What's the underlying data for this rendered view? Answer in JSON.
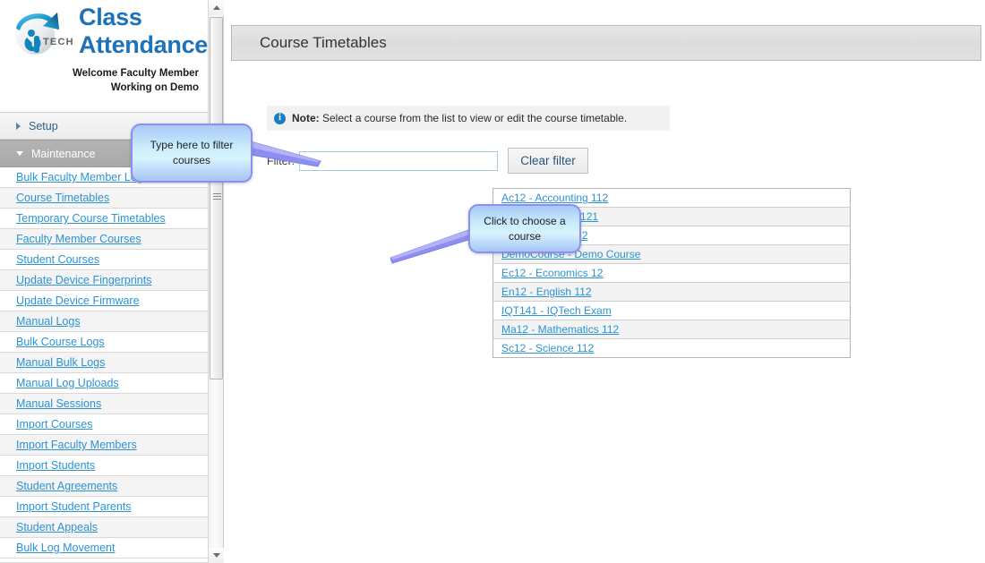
{
  "brand": {
    "logo_icon": "iqtech-globe-logo",
    "title_line1": "Class",
    "title_line2": "Attendance",
    "welcome_line1": "Welcome Faculty Member",
    "welcome_line2": "Working on Demo",
    "accent_color": "#1d72b8"
  },
  "sidebar": {
    "sections": [
      {
        "label": "Setup",
        "expanded": false,
        "icon": "chevron-right-icon"
      },
      {
        "label": "Maintenance",
        "expanded": true,
        "icon": "chevron-down-icon"
      }
    ],
    "items": [
      {
        "label": "Bulk Faculty Member Logs"
      },
      {
        "label": "Course Timetables"
      },
      {
        "label": "Temporary Course Timetables"
      },
      {
        "label": "Faculty Member Courses"
      },
      {
        "label": "Student Courses"
      },
      {
        "label": "Update Device Fingerprints"
      },
      {
        "label": "Update Device Firmware"
      },
      {
        "label": "Manual Logs"
      },
      {
        "label": "Bulk Course Logs"
      },
      {
        "label": "Manual Bulk Logs"
      },
      {
        "label": "Manual Log Uploads"
      },
      {
        "label": "Manual Sessions"
      },
      {
        "label": "Import Courses"
      },
      {
        "label": "Import Faculty Members"
      },
      {
        "label": "Import Students"
      },
      {
        "label": "Student Agreements"
      },
      {
        "label": "Import Student Parents"
      },
      {
        "label": "Student Appeals"
      },
      {
        "label": "Bulk Log Movement"
      }
    ],
    "link_color": "#2b93d4"
  },
  "scrollbar": {
    "up_arrow_icon": "scroll-up-arrow-icon",
    "down_arrow_icon": "scroll-down-arrow-icon",
    "grip_icon": "scrollbar-grip-icon"
  },
  "main": {
    "page_title": "Course Timetables",
    "note": {
      "icon": "info-icon",
      "prefix": "Note:",
      "text": " Select a course from the list to view or edit the course timetable."
    },
    "filter": {
      "label": "Filter:",
      "value": "",
      "placeholder": "",
      "clear_button": "Clear filter"
    },
    "courses": [
      {
        "label": "Ac12 - Accounting 112"
      },
      {
        "label": "Af12 - Afrikaans 121"
      },
      {
        "label": "Bi12 - Biology 112"
      },
      {
        "label": "DemoCourse - Demo Course"
      },
      {
        "label": "Ec12 - Economics 12"
      },
      {
        "label": "En12 - English 112"
      },
      {
        "label": "IQT141 - IQTech Exam"
      },
      {
        "label": "Ma12 - Mathematics 112"
      },
      {
        "label": "Sc12 - Science 112"
      }
    ]
  },
  "callouts": {
    "filter_hint": "Type here to filter courses",
    "course_hint": "Click to choose a course",
    "border_color": "#8e8ef0",
    "fill_color": "#c8ecfb"
  }
}
